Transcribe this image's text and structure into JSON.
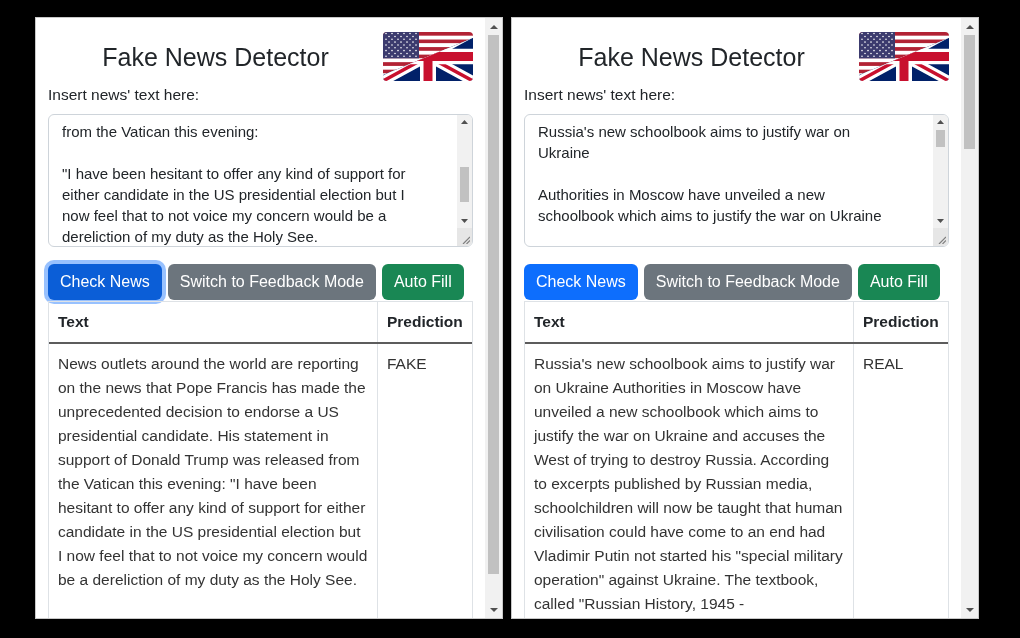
{
  "panels": [
    {
      "title": "Fake News Detector",
      "label": "Insert news' text here:",
      "textarea": {
        "value": "from the Vatican this evening:\n\n\"I have been hesitant to offer any kind of support for either candidate in the US presidential election but I now feel that to not voice my concern would be a dereliction of my duty as the Holy See."
      },
      "buttons": [
        {
          "kind": "primary",
          "label": "Check News",
          "focused": true
        },
        {
          "kind": "secondary",
          "label": "Switch to Feedback Mode",
          "focused": false
        },
        {
          "kind": "success",
          "label": "Auto Fill",
          "focused": false
        }
      ],
      "table": {
        "columns": [
          "Text",
          "Prediction"
        ],
        "rows": [
          {
            "text": "News outlets around the world are reporting on the news that Pope Francis has made the unprecedented decision to endorse a US presidential candidate. His statement in support of Donald Trump was released from the Vatican this evening: \"I have been hesitant to offer any kind of support for either candidate in the US presidential election but I now feel that to not voice my concern would be a dereliction of my duty as the Holy See.",
            "prediction": "FAKE"
          }
        ]
      }
    },
    {
      "title": "Fake News Detector",
      "label": "Insert news' text here:",
      "textarea": {
        "value": "Russia's new schoolbook aims to justify war on Ukraine\n\nAuthorities in Moscow have unveiled a new schoolbook which aims to justify the war on Ukraine"
      },
      "buttons": [
        {
          "kind": "primary",
          "label": "Check News",
          "focused": false
        },
        {
          "kind": "secondary",
          "label": "Switch to Feedback Mode",
          "focused": false
        },
        {
          "kind": "success",
          "label": "Auto Fill",
          "focused": false
        }
      ],
      "table": {
        "columns": [
          "Text",
          "Prediction"
        ],
        "rows": [
          {
            "text": "Russia's new schoolbook aims to justify war on Ukraine Authorities in Moscow have unveiled a new schoolbook which aims to justify the war on Ukraine and accuses the West of trying to destroy Russia. According to excerpts published by Russian media, schoolchildren will now be taught that human civilisation could have come to an end had Vladimir Putin not started his \"special military operation\" against Ukraine. The textbook, called \"Russian History, 1945 -",
            "prediction": "REAL"
          }
        ]
      }
    }
  ]
}
